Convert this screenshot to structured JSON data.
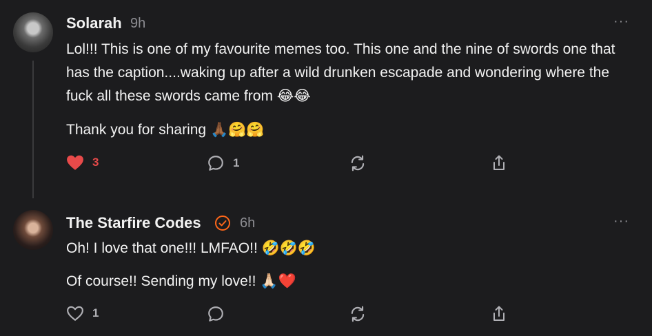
{
  "comments": [
    {
      "author": "Solarah",
      "time": "9h",
      "more": "···",
      "paragraphs": [
        "Lol!!! This is one of my favourite memes too. This one and the nine of swords one that has the caption....waking up after a wild drunken escapade and wondering where the fuck all these swords came from 😂😂",
        "Thank you for sharing 🙏🏾🤗🤗"
      ],
      "likes": "3",
      "liked": true,
      "replies": "1"
    },
    {
      "author": "The Starfire Codes",
      "time": "6h",
      "more": "···",
      "verified": true,
      "paragraphs": [
        "Oh! I love that one!!! LMFAO!! 🤣🤣🤣",
        "Of course!! Sending my love!! 🙏🏻❤️"
      ],
      "likes": "1",
      "liked": false,
      "replies": ""
    }
  ],
  "colors": {
    "background": "#1c1c1e",
    "accent": "#ff6719",
    "liked": "#e84a4a"
  }
}
